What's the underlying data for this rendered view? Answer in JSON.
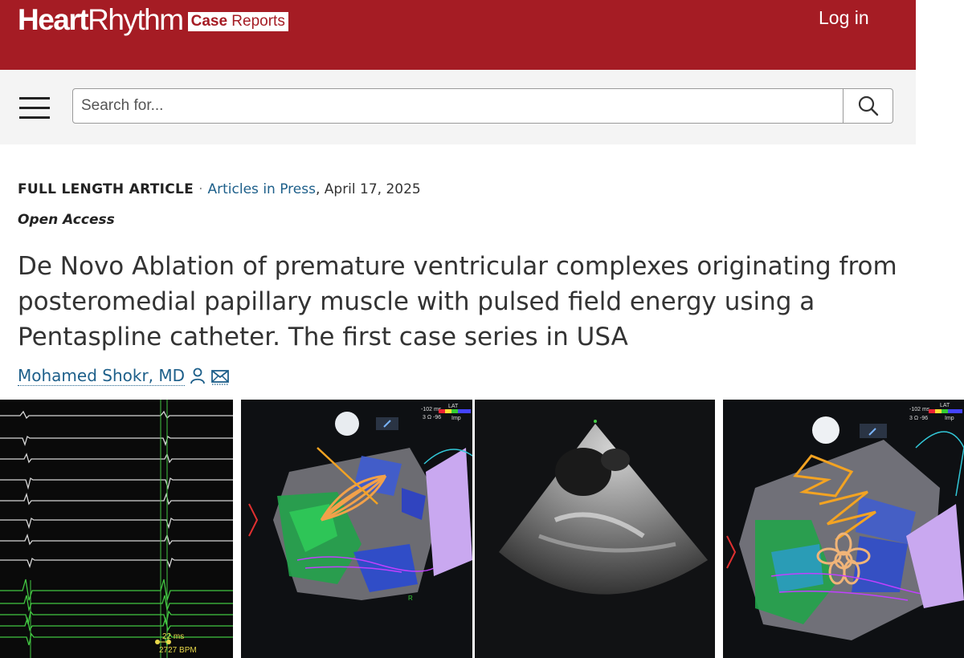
{
  "header": {
    "logo": {
      "heart": "Heart",
      "rhythm": "Rhythm",
      "badge_bold": "Case",
      "badge_rest": " Reports"
    },
    "login_label": "Log in",
    "brand_color": "#a51c24"
  },
  "search": {
    "placeholder": "Search for...",
    "value": "",
    "icon": "search-icon",
    "menu_icon": "hamburger-menu-icon"
  },
  "article": {
    "type": "FULL LENGTH ARTICLE",
    "separator": "·",
    "status_link": "Articles in Press",
    "date": ", April 17, 2025",
    "access": "Open Access",
    "title": "De Novo Ablation of premature ventricular complexes originating from posteromedial papillary muscle with pulsed field energy using a Pentaspline catheter. The first case series in USA",
    "author": "Mohamed Shokr, MD",
    "author_icons": [
      "person-icon",
      "email-icon"
    ],
    "link_color": "#1d5f8a"
  },
  "figures": {
    "panel1": {
      "readout_ms": "22 ms",
      "readout_bpm": "2727 BPM"
    },
    "panel2": {
      "legend_title": "LAT",
      "scale_top": "-102 ms",
      "scale_mid": "3 Ω -96",
      "scale_right": "Imp",
      "marker": "R"
    },
    "panel4": {
      "legend_title": "LAT",
      "scale_top": "-102 ms",
      "scale_mid": "3 Ω -96",
      "scale_right": "Imp"
    }
  }
}
